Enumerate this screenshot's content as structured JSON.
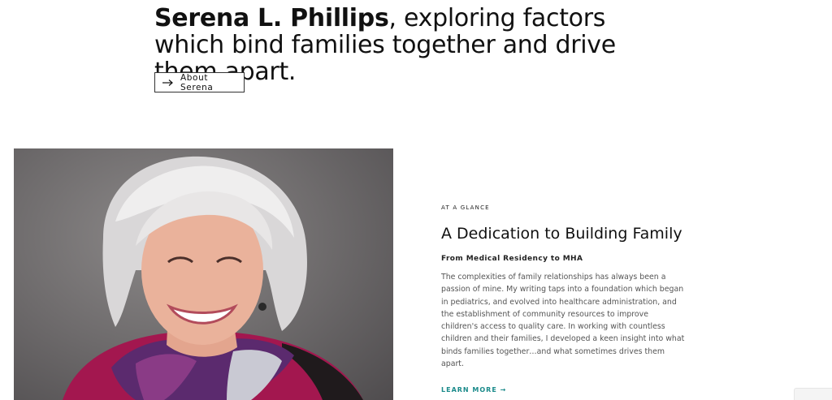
{
  "hero": {
    "name": "Serena L. Phillips",
    "headline_rest": ", exploring factors which bind families together and drive them apart.",
    "about_button_label": "About Serena",
    "about_button_icon": "arrow-right-icon"
  },
  "portrait": {
    "icon": "portrait-photo"
  },
  "glance": {
    "eyebrow": "AT A GLANCE",
    "title": "A Dedication to Building Family",
    "subtitle": "From Medical Residency to MHA",
    "body": "The complexities of family relationships has always been a passion of mine. My writing taps into a foundation which began in pediatrics, and evolved into healthcare administration, and the establishment of community resources to improve children's access to quality care. In working with countless children and their families, I developed a keen insight into what binds families together…and what sometimes drives them apart.",
    "learn_more_label": "LEARN MORE →",
    "accent_color": "#1a8a8a"
  }
}
